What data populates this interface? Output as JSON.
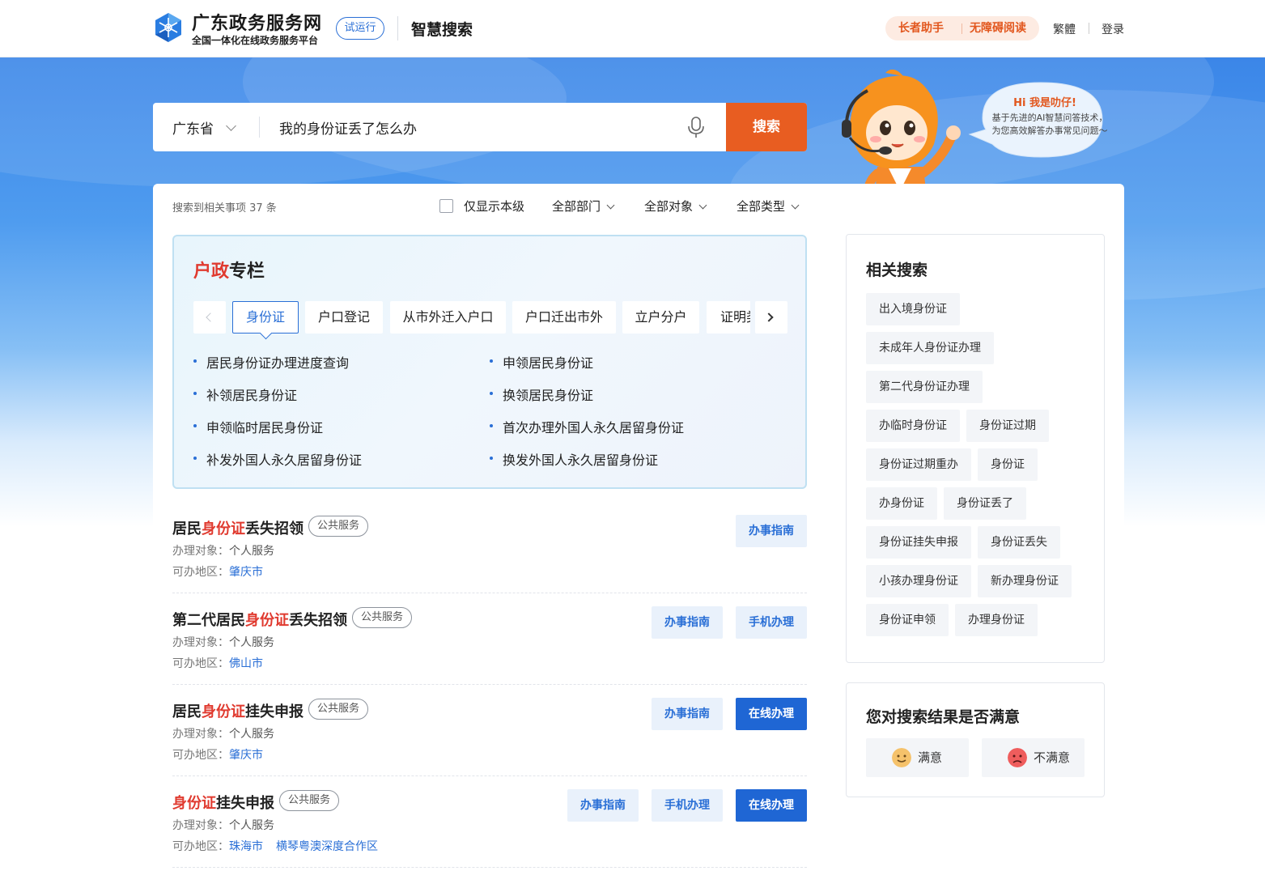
{
  "header": {
    "site_title": "广东政务服务网",
    "site_subtitle": "全国一体化在线政务服务平台",
    "trial_badge": "试运行",
    "page_name": "智慧搜索",
    "elder_assist": "长者助手",
    "accessible_reading": "无障碍阅读",
    "traditional": "繁體",
    "login": "登录"
  },
  "search": {
    "region": "广东省",
    "query": "我的身份证丢了怎么办",
    "button": "搜索"
  },
  "assistant": {
    "greeting": "Hi 我是叻仔!",
    "intro_line1": "基于先进的AI智慧问答技术，",
    "intro_line2": "为您高效解答办事常见问题～"
  },
  "filters": {
    "result_count": "搜索到相关事项 37 条",
    "only_this_level": "仅显示本级",
    "department": "全部部门",
    "target": "全部对象",
    "type": "全部类型"
  },
  "column": {
    "title_highlight": "户政",
    "title_rest": "专栏",
    "tabs": [
      "身份证",
      "户口登记",
      "从市外迁入户口",
      "户口迁出市外",
      "立户分户",
      "证明类"
    ],
    "items": [
      "居民身份证办理进度查询",
      "申领居民身份证",
      "补领居民身份证",
      "换领居民身份证",
      "申领临时居民身份证",
      "首次办理外国人永久居留身份证",
      "补发外国人永久居留身份证",
      "换发外国人永久居留身份证"
    ]
  },
  "results": [
    {
      "title_pre": "居民",
      "title_hl": "身份证",
      "title_post": "丢失招领",
      "tag": "公共服务",
      "target_label": "办理对象：",
      "target": "个人服务",
      "region_label": "可办地区：",
      "regions": [
        "肇庆市"
      ],
      "buttons": [
        "办事指南"
      ]
    },
    {
      "title_pre": "第二代居民",
      "title_hl": "身份证",
      "title_post": "丢失招领",
      "tag": "公共服务",
      "target_label": "办理对象：",
      "target": "个人服务",
      "region_label": "可办地区：",
      "regions": [
        "佛山市"
      ],
      "buttons": [
        "办事指南",
        "手机办理"
      ]
    },
    {
      "title_pre": "居民",
      "title_hl": "身份证",
      "title_post": "挂失申报",
      "tag": "公共服务",
      "target_label": "办理对象：",
      "target": "个人服务",
      "region_label": "可办地区：",
      "regions": [
        "肇庆市"
      ],
      "buttons": [
        "办事指南",
        "在线办理"
      ]
    },
    {
      "title_pre": "",
      "title_hl": "身份证",
      "title_post": "挂失申报",
      "tag": "公共服务",
      "target_label": "办理对象：",
      "target": "个人服务",
      "region_label": "可办地区：",
      "regions": [
        "珠海市",
        "横琴粤澳深度合作区"
      ],
      "buttons": [
        "办事指南",
        "手机办理",
        "在线办理"
      ]
    }
  ],
  "related": {
    "title": "相关搜索",
    "chips": [
      "出入境身份证",
      "未成年人身份证办理",
      "第二代身份证办理",
      "办临时身份证",
      "身份证过期",
      "身份证过期重办",
      "身份证",
      "办身份证",
      "身份证丢了",
      "身份证挂失申报",
      "身份证丢失",
      "小孩办理身份证",
      "新办理身份证",
      "身份证申领",
      "办理身份证"
    ]
  },
  "satisfaction": {
    "title": "您对搜索结果是否满意",
    "satisfied": "满意",
    "unsatisfied": "不满意"
  },
  "colors": {
    "brand_blue": "#2a6fd6",
    "accent_orange": "#e85d21",
    "highlight_red": "#e03a2f"
  }
}
